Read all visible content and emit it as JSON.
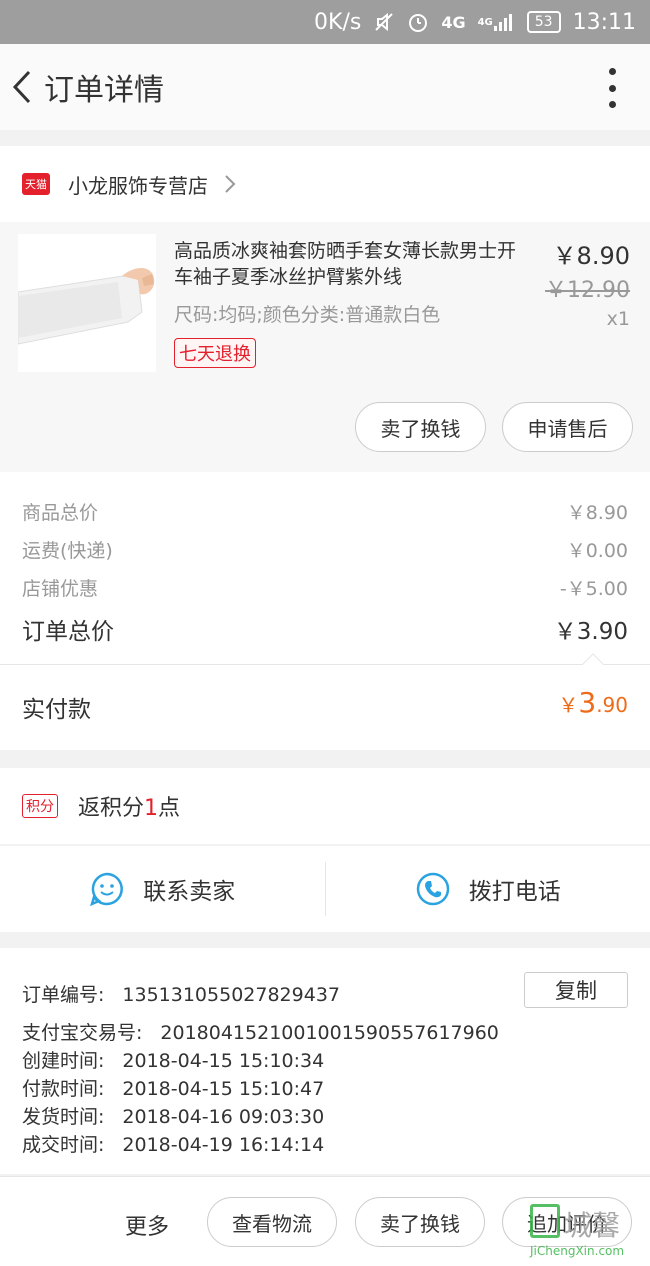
{
  "status_bar": {
    "speed": "0K/s",
    "network": "4G",
    "network2": "4G",
    "battery": "53",
    "time": "13:11"
  },
  "header": {
    "title": "订单详情"
  },
  "shop": {
    "badge": "天猫",
    "name": "小龙服饰专营店"
  },
  "product": {
    "title": "高品质冰爽袖套防晒手套女薄长款男士开车袖子夏季冰丝护臂紫外线",
    "spec": "尺码:均码;颜色分类:普通款白色",
    "tag": "七天退换",
    "price": "￥8.90",
    "original_price": "￥12.90",
    "quantity": "x1",
    "buttons": {
      "sell": "卖了换钱",
      "after_sale": "申请售后"
    }
  },
  "summary": {
    "rows": [
      {
        "label": "商品总价",
        "value": "￥8.90"
      },
      {
        "label": "运费(快递)",
        "value": "￥0.00"
      },
      {
        "label": "店铺优惠",
        "value": "-￥5.00"
      }
    ],
    "total_label": "订单总价",
    "total_value": "￥3.90",
    "paid_label": "实付款",
    "paid_currency": "￥",
    "paid_int": "3",
    "paid_dec": ".90"
  },
  "points": {
    "badge": "积分",
    "prefix": "返积分",
    "count": "1",
    "suffix": "点"
  },
  "contact": {
    "seller": "联系卖家",
    "call": "拨打电话"
  },
  "order_info": {
    "order_no_label": "订单编号:",
    "order_no": "135131055027829437",
    "copy": "复制",
    "alipay_label": "支付宝交易号:",
    "alipay_no": "2018041521001001590557617960",
    "created_label": "创建时间:",
    "created": "2018-04-15 15:10:34",
    "paid_label": "付款时间:",
    "paid": "2018-04-15 15:10:47",
    "shipped_label": "发货时间:",
    "shipped": "2018-04-16 09:03:30",
    "closed_label": "成交时间:",
    "closed": "2018-04-19 16:14:14"
  },
  "bottom_bar": {
    "more": "更多",
    "logistics": "查看物流",
    "sell": "卖了换钱",
    "review": "追加评价"
  },
  "watermark": {
    "text": "城馨",
    "sub": "JiChengXin.com"
  },
  "colors": {
    "accent_red": "#e5202d",
    "paid_orange": "#ee6b1a",
    "icon_blue": "#2aa3e0",
    "watermark_green": "#39b54a"
  }
}
